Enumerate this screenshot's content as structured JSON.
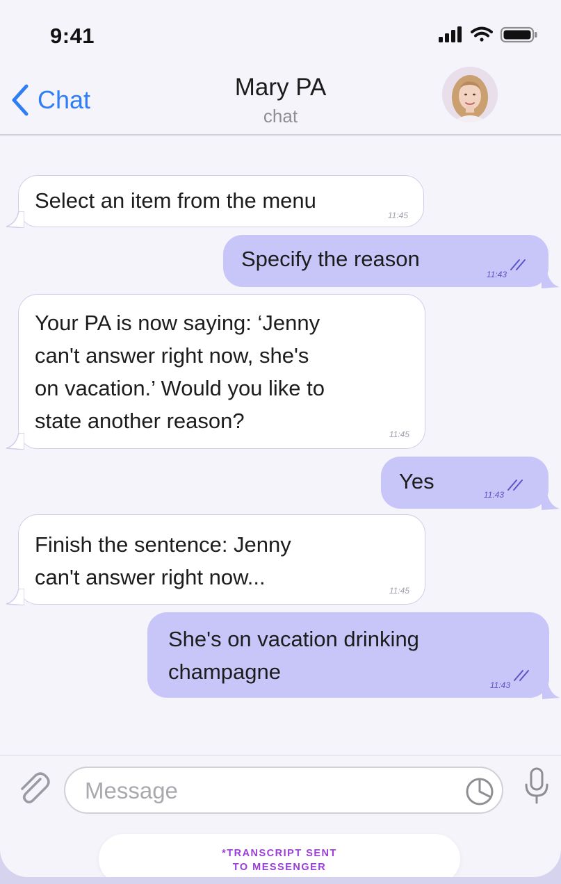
{
  "status_bar": {
    "time": "9:41"
  },
  "header": {
    "back_label": "Chat",
    "title": "Mary PA",
    "subtitle": "chat"
  },
  "messages": [
    {
      "direction": "in",
      "text": "Select an item from the menu",
      "time": "11:45"
    },
    {
      "direction": "out",
      "text": "Specify the reason",
      "time": "11:43",
      "read": true
    },
    {
      "direction": "in",
      "text": "Your PA is now saying: ‘Jenny\ncan't answer right now, she's\non vacation.’ Would you like to\nstate another reason?",
      "time": "11:45"
    },
    {
      "direction": "out",
      "text": "Yes",
      "time": "11:43",
      "read": true
    },
    {
      "direction": "in",
      "text": "Finish the sentence: Jenny\ncan't answer right now...",
      "time": "11:45"
    },
    {
      "direction": "out",
      "text": "She's on vacation drinking\nchampagne",
      "time": "11:43",
      "read": true
    }
  ],
  "composer": {
    "placeholder": "Message"
  },
  "footer": {
    "transcript_label": "*TRANSCRIPT SENT\nTO MESSENGER"
  },
  "colors": {
    "accent": "#2f7ef5",
    "outgoing_bubble": "#c8c6f8",
    "incoming_bubble": "#ffffff",
    "transcript_text": "#9b3dd8"
  }
}
